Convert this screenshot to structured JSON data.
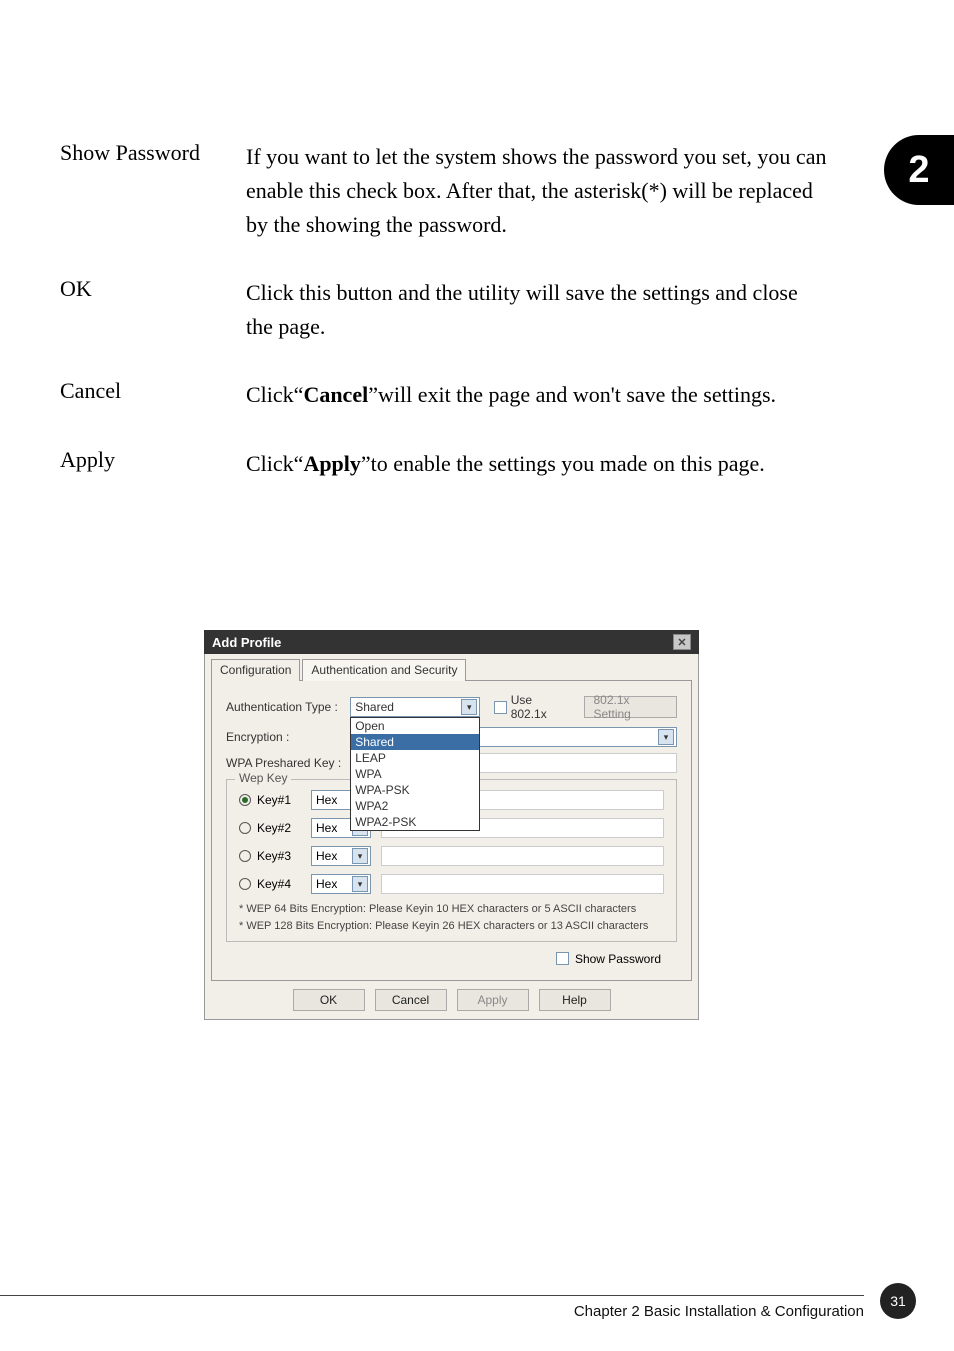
{
  "chapter_badge": "2",
  "definitions": [
    {
      "term": "Show Password",
      "desc_pre": "If you want to let the system shows the password you set, you can enable this check box. After that, the asterisk(*) will be replaced by the showing the password.",
      "bold": "",
      "desc_post": ""
    },
    {
      "term": "OK",
      "desc_pre": "Click this button and the utility will save the settings and close the page.",
      "bold": "",
      "desc_post": ""
    },
    {
      "term": "Cancel",
      "desc_pre": "Click“",
      "bold": "Cancel",
      "desc_post": "”will exit the page and won't save the settings."
    },
    {
      "term": "Apply",
      "desc_pre": "Click“",
      "bold": "Apply",
      "desc_post": "”to enable the settings you made on this page."
    }
  ],
  "dialog": {
    "title": "Add Profile",
    "tabs": {
      "config": "Configuration",
      "auth": "Authentication and Security"
    },
    "fields": {
      "auth_type_label": "Authentication Type :",
      "auth_type_value": "Shared",
      "auth_type_options": [
        "Open",
        "Shared",
        "LEAP",
        "WPA",
        "WPA-PSK",
        "WPA2",
        "WPA2-PSK"
      ],
      "use8021x_label": "Use 802.1x",
      "setting8021x_label": "802.1x Setting",
      "encryption_label": "Encryption :",
      "wpa_psk_label": "WPA Preshared Key :",
      "wep_group": "Wep Key",
      "keys": [
        {
          "label": "Key#1",
          "fmt": "Hex",
          "selected": true
        },
        {
          "label": "Key#2",
          "fmt": "Hex",
          "selected": false
        },
        {
          "label": "Key#3",
          "fmt": "Hex",
          "selected": false
        },
        {
          "label": "Key#4",
          "fmt": "Hex",
          "selected": false
        }
      ],
      "hint1": "* WEP 64 Bits Encryption:  Please Keyin 10 HEX characters or 5 ASCII characters",
      "hint2": "* WEP 128 Bits Encryption:  Please Keyin 26 HEX characters or 13 ASCII characters",
      "show_password": "Show Password"
    },
    "buttons": {
      "ok": "OK",
      "cancel": "Cancel",
      "apply": "Apply",
      "help": "Help"
    }
  },
  "footer": {
    "text": "Chapter 2 Basic Installation & Configuration",
    "page": "31"
  }
}
